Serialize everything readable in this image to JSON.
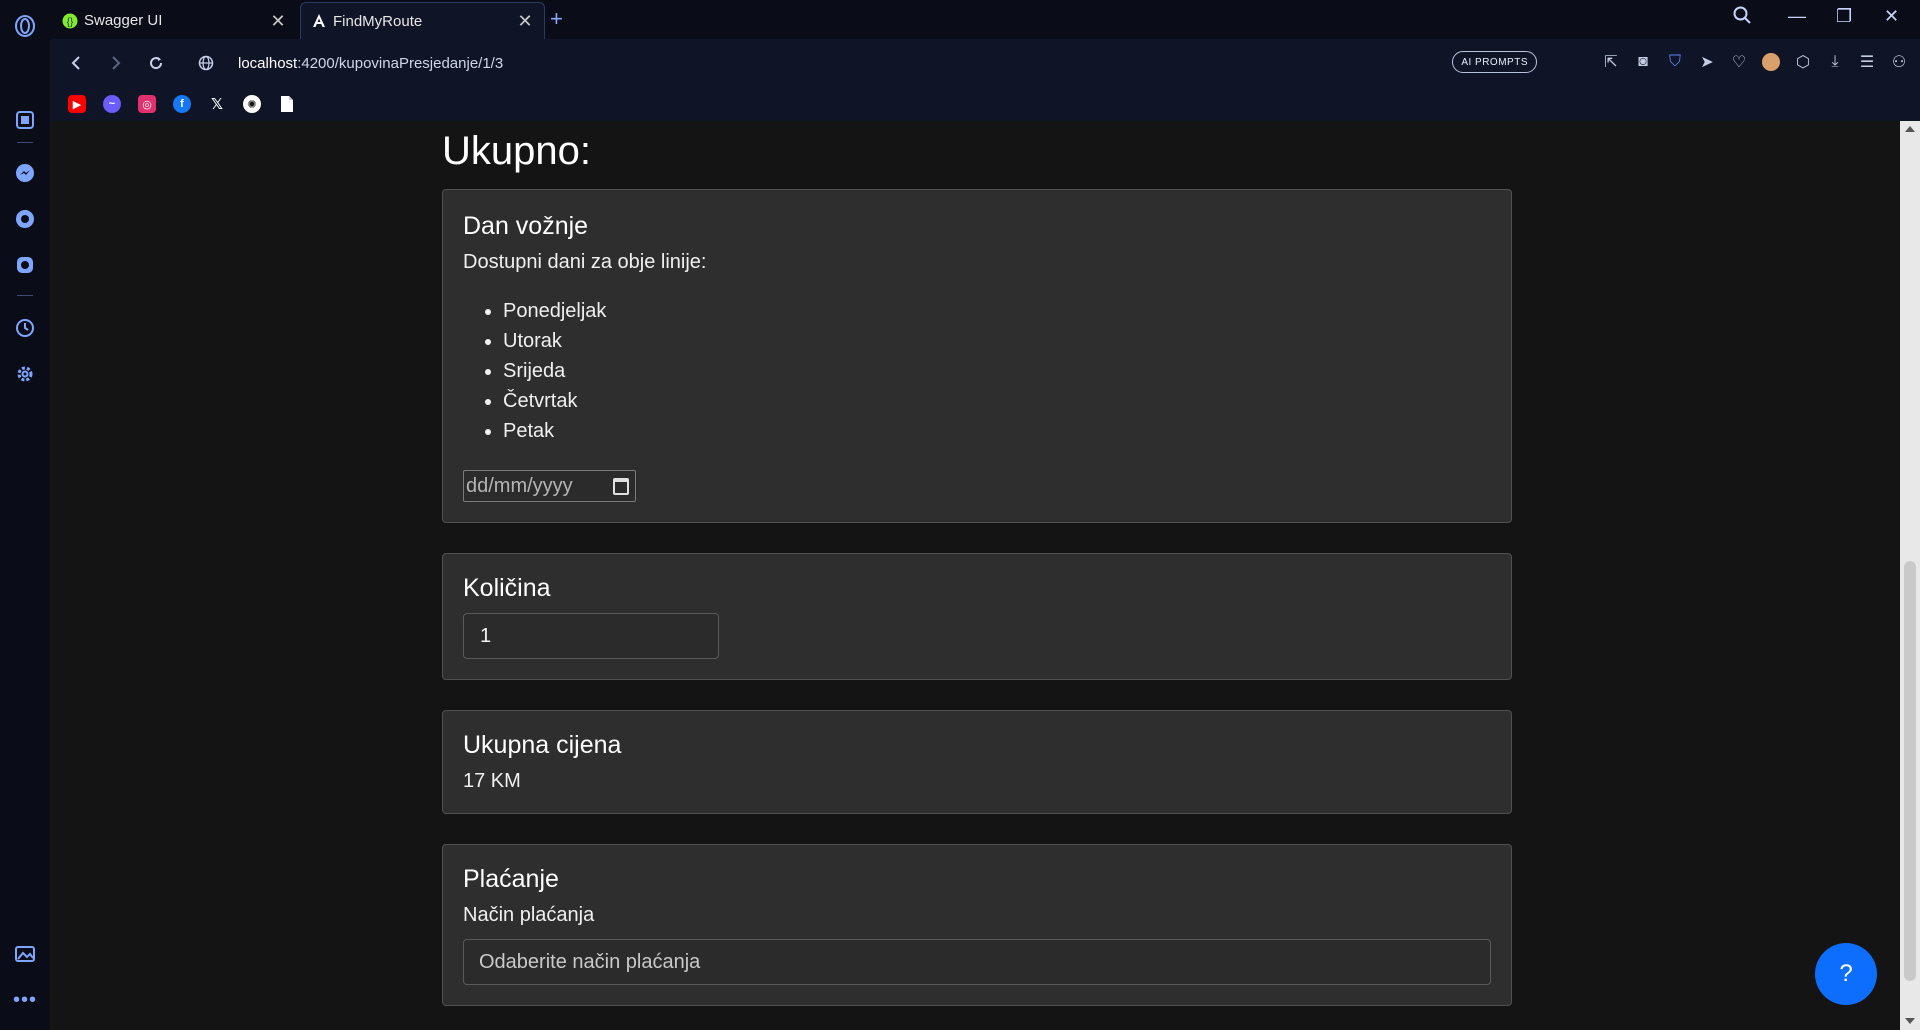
{
  "browser": {
    "tabs": [
      {
        "label": "Swagger UI",
        "icon": "swagger-icon"
      },
      {
        "label": "FindMyRoute",
        "icon": "angular-icon"
      }
    ],
    "url_host": "localhost",
    "url_path": ":4200/kupovinaPresjedanje/1/3",
    "ai_prompts_label": "AI PROMPTS"
  },
  "page": {
    "title": "Ukupno:",
    "day_card": {
      "heading": "Dan vožnje",
      "subtitle": "Dostupni dani za obje linije:",
      "days": [
        "Ponedjeljak",
        "Utorak",
        "Srijeda",
        "Četvrtak",
        "Petak"
      ],
      "date_placeholder": "dd/mm/yyyy"
    },
    "quantity_card": {
      "heading": "Količina",
      "value": "1"
    },
    "total_card": {
      "heading": "Ukupna cijena",
      "value": "17 KM"
    },
    "payment_card": {
      "heading": "Plaćanje",
      "label": "Način plaćanja",
      "placeholder": "Odaberite način plaćanja"
    },
    "help_label": "?"
  },
  "colors": {
    "accent": "#0d6efd",
    "page_bg": "#141414",
    "card_bg": "#2e2e2e"
  }
}
